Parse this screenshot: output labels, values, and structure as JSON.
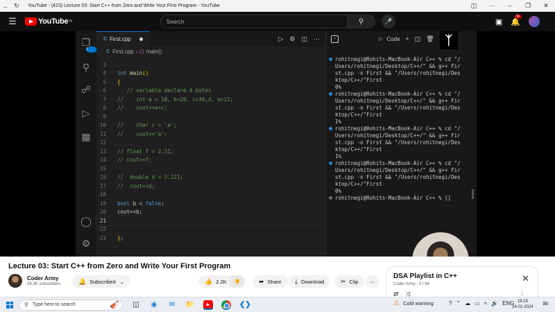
{
  "window": {
    "title": "YouTube - (423) Lecture 03: Start C++ from Zero and Write Your First Program - YouTube"
  },
  "youtube": {
    "logo_text": "YouTube",
    "logo_region": "IN",
    "search_placeholder": "Search",
    "notification_count": "9+"
  },
  "vscode": {
    "tab_label": "First.cpp",
    "file_icon": "C",
    "breadcrumb_file": "First.cpp",
    "breadcrumb_symbol": "main()",
    "code_lines": [
      {
        "n": "3",
        "t": ""
      },
      {
        "n": "4",
        "t": "int main()"
      },
      {
        "n": "5",
        "t": "{"
      },
      {
        "n": "6",
        "t": "   // variable declare 4 bytes"
      },
      {
        "n": "7",
        "t": "//    int a = 10, b=20, c=30,d, e=11;"
      },
      {
        "n": "8",
        "t": "//    cout<<a+c;"
      },
      {
        "n": "9",
        "t": ""
      },
      {
        "n": "10",
        "t": "//    char c = 'a';"
      },
      {
        "n": "11",
        "t": "//    cout<<'a';"
      },
      {
        "n": "12",
        "t": ""
      },
      {
        "n": "13",
        "t": "// float f = 2.31;"
      },
      {
        "n": "14",
        "t": "// cout<<f;"
      },
      {
        "n": "15",
        "t": ""
      },
      {
        "n": "16",
        "t": "//  double d = 3.121;"
      },
      {
        "n": "17",
        "t": "//  cout<<d;"
      },
      {
        "n": "18",
        "t": ""
      },
      {
        "n": "19",
        "t": "bool b = false;"
      },
      {
        "n": "20",
        "t": "cout<<b;"
      },
      {
        "n": "21",
        "t": ""
      },
      {
        "n": "22",
        "t": ""
      },
      {
        "n": "23",
        "t": "};"
      }
    ],
    "terminal_label": "Code",
    "terminal_lines": [
      {
        "bullet": "blue",
        "t": "rohitnegi@Rohits-MacBook-Air C++ % cd \"/"
      },
      {
        "bullet": "",
        "t": "Users/rohitnegi/Desktop/C++/\" && g++ Fir"
      },
      {
        "bullet": "",
        "t": "st.cpp -o First && \"/Users/rohitnegi/Des"
      },
      {
        "bullet": "",
        "t": "ktop/C++/\"First"
      },
      {
        "bullet": "",
        "t": "0%"
      },
      {
        "bullet": "blue",
        "t": "rohitnegi@Rohits-MacBook-Air C++ % cd \"/"
      },
      {
        "bullet": "",
        "t": "Users/rohitnegi/Desktop/C++/\" && g++ Fir"
      },
      {
        "bullet": "",
        "t": "st.cpp -o First && \"/Users/rohitnegi/Des"
      },
      {
        "bullet": "",
        "t": "ktop/C++/\"First"
      },
      {
        "bullet": "",
        "t": "1%"
      },
      {
        "bullet": "blue",
        "t": "rohitnegi@Rohits-MacBook-Air C++ % cd \"/"
      },
      {
        "bullet": "",
        "t": "Users/rohitnegi/Desktop/C++/\" && g++ Fir"
      },
      {
        "bullet": "",
        "t": "st.cpp -o First && \"/Users/rohitnegi/Des"
      },
      {
        "bullet": "",
        "t": "ktop/C++/\"First"
      },
      {
        "bullet": "",
        "t": "1%"
      },
      {
        "bullet": "blue",
        "t": "rohitnegi@Rohits-MacBook-Air C++ % cd \"/"
      },
      {
        "bullet": "",
        "t": "Users/rohitnegi/Desktop/C++/\" && g++ Fir"
      },
      {
        "bullet": "",
        "t": "st.cpp -o First && \"/Users/rohitnegi/Des"
      },
      {
        "bullet": "",
        "t": "ktop/C++/\"First"
      },
      {
        "bullet": "",
        "t": "0%"
      },
      {
        "bullet": "grey",
        "t": "rohitnegi@Rohits-MacBook-Air C++ % []"
      }
    ]
  },
  "video": {
    "title": "Lecture 03: Start C++ from Zero and Write Your First Program",
    "channel": "Coder Army",
    "subscribers": "58.3K subscribers",
    "subscribed_label": "Subscribed",
    "likes": "2.2K",
    "share_label": "Share",
    "download_label": "Download",
    "clip_label": "Clip"
  },
  "playlist": {
    "title": "DSA Playlist in C++",
    "subtitle": "Coder Army - 3 / 84"
  },
  "taskbar": {
    "search_placeholder": "Type here to search",
    "weather": "Cold warning",
    "language": "ENG",
    "time": "19:19",
    "date": "24-01-2024"
  },
  "colors": {
    "yt_red": "#ff0000",
    "vscode_accent": "#0078d4",
    "bg_dark": "#0f0f0f"
  }
}
